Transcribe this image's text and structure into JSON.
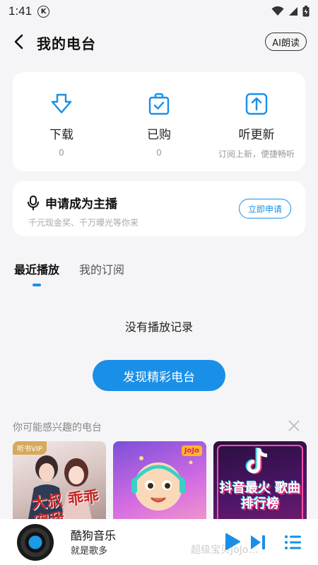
{
  "status_bar": {
    "time": "1:41",
    "badge": "K"
  },
  "header": {
    "title": "我的电台",
    "ai_button": "AI朗读"
  },
  "actions": [
    {
      "label": "下载",
      "sub": "0",
      "icon": "download-icon"
    },
    {
      "label": "已购",
      "sub": "0",
      "icon": "purchased-bag-icon"
    },
    {
      "label": "听更新",
      "sub": "订阅上新，便捷畅听",
      "icon": "upload-update-icon"
    }
  ],
  "anchor": {
    "title": "申请成为主播",
    "subtitle": "千元现金奖、千万曝光等你来",
    "button": "立即申请"
  },
  "tabs": [
    {
      "label": "最近播放",
      "active": true
    },
    {
      "label": "我的订阅",
      "active": false
    }
  ],
  "empty": {
    "text": "没有播放记录",
    "button": "发现精彩电台"
  },
  "recommend": {
    "title": "你可能感兴趣的电台",
    "cards": [
      {
        "tag": "听书VIP",
        "cover_text": "大叔 乖乖宠我"
      },
      {
        "logo": "JoJo"
      },
      {
        "cover_text": "抖音最火 歌曲排行榜"
      }
    ]
  },
  "player": {
    "title": "酷狗音乐",
    "subtitle": "就是歌多",
    "ghost_text": "超级宝贝JoJo…"
  },
  "colors": {
    "accent": "#1890e8",
    "background": "#f5f5f7"
  }
}
